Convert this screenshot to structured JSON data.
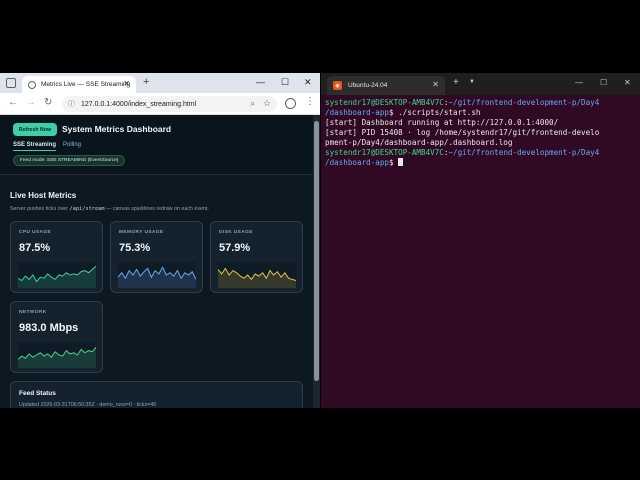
{
  "browser": {
    "tab_title": "Metrics Live — SSE Streaming",
    "url": "127.0.0.1:4000/index_streaming.html"
  },
  "dashboard": {
    "refresh_label": "Refresh Now",
    "title": "System Metrics Dashboard",
    "tabs": [
      {
        "label": "SSE Streaming",
        "active": true
      },
      {
        "label": "Polling",
        "active": false
      }
    ],
    "feed_mode": "Feed mode: SSE STREAMING (EventSource)",
    "section_title": "Live Host Metrics",
    "section_desc_pre": "Server pushes ticks over",
    "section_desc_code": "/api/stream",
    "section_desc_post": "— canvas sparklines redraw on each event.",
    "cards": [
      {
        "label": "CPU USAGE",
        "value": "87.5%",
        "color": "#3ecfa8",
        "spark": [
          0.35,
          0.25,
          0.45,
          0.3,
          0.5,
          0.2,
          0.4,
          0.35,
          0.55,
          0.4,
          0.3,
          0.5,
          0.45,
          0.6,
          0.5,
          0.55,
          0.5,
          0.65,
          0.7,
          0.6,
          0.75,
          0.9
        ]
      },
      {
        "label": "MEMORY USAGE",
        "value": "75.3%",
        "color": "#6aa7f0",
        "spark": [
          0.4,
          0.6,
          0.35,
          0.7,
          0.5,
          0.75,
          0.45,
          0.65,
          0.8,
          0.4,
          0.7,
          0.55,
          0.85,
          0.5,
          0.6,
          0.45,
          0.7,
          0.35,
          0.6,
          0.5,
          0.65,
          0.3
        ]
      },
      {
        "label": "DISK USAGE",
        "value": "57.9%",
        "color": "#e6c24a",
        "spark": [
          0.75,
          0.55,
          0.8,
          0.5,
          0.7,
          0.6,
          0.45,
          0.35,
          0.5,
          0.3,
          0.55,
          0.45,
          0.6,
          0.35,
          0.7,
          0.5,
          0.65,
          0.4,
          0.6,
          0.35,
          0.3,
          0.25
        ]
      },
      {
        "label": "NETWORK",
        "value": "983.0 Mbps",
        "color": "#4fd08a",
        "spark": [
          0.3,
          0.45,
          0.35,
          0.55,
          0.4,
          0.5,
          0.6,
          0.45,
          0.55,
          0.4,
          0.65,
          0.5,
          0.45,
          0.7,
          0.55,
          0.6,
          0.5,
          0.75,
          0.6,
          0.7,
          0.65,
          0.85
        ]
      }
    ],
    "status_title": "Feed Status",
    "status_line": "Updated 2026-03-31T06:50:35Z · demo_runs=0 · ticks=46"
  },
  "terminal": {
    "tab_title": "Ubuntu-24.04",
    "user": "systendr17@DESKTOP-AMB4V7C",
    "path": "~/git/frontend-development-p/Day4/dashboard-app",
    "command": "./scripts/start.sh",
    "out1": "[start] Dashboard running at http://127.0.0.1:4000/",
    "out2": "[start] PID 15408 · log /home/systendr17/git/frontend-develo",
    "out3": "pment-p/Day4/dashboard-app/.dashboard.log",
    "path_line1": "~/git/frontend-development-p/Day4",
    "path_line2": "/dashboard-app"
  }
}
